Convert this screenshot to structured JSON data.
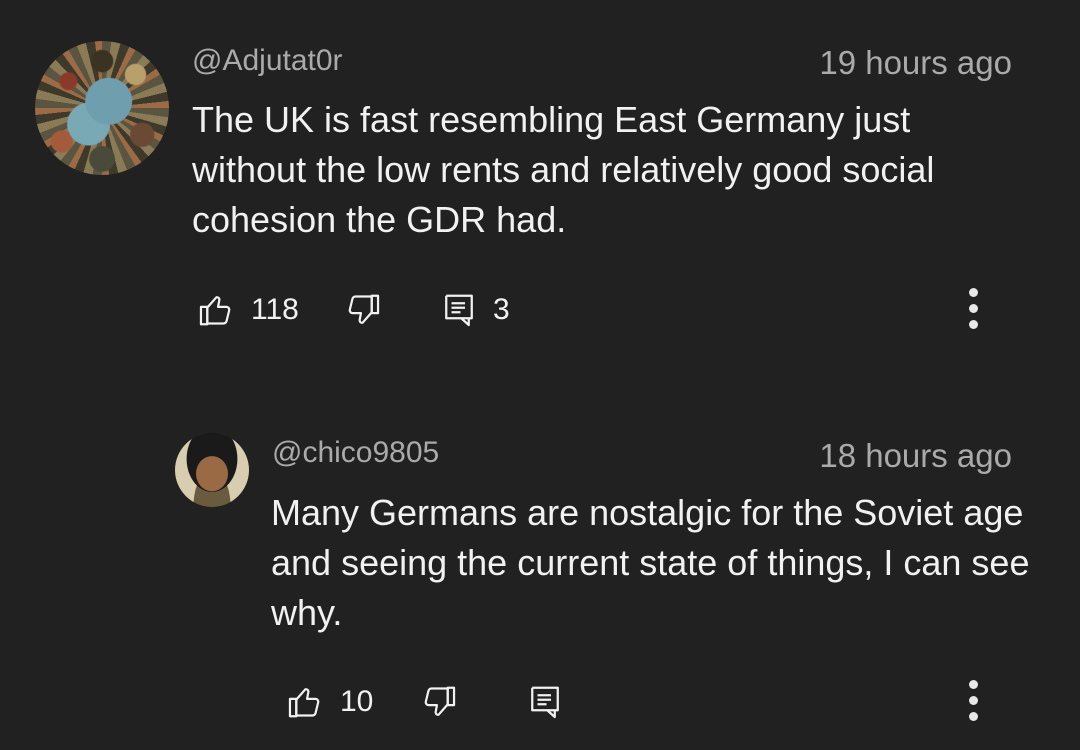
{
  "comments": [
    {
      "author": "@Adjutat0r",
      "time": "19 hours ago",
      "text": "The UK is fast resembling East Germany just without the low rents and relatively good social cohesion the GDR had.",
      "likes": "118",
      "replies": "3",
      "icons": {
        "like": "thumbs-up-icon",
        "dislike": "thumbs-down-icon",
        "reply": "reply-icon",
        "more": "more-vert-icon"
      }
    },
    {
      "author": "@chico9805",
      "time": "18 hours ago",
      "text": "Many Germans are nostalgic for the Soviet age and seeing the current state of things, I can see why.",
      "likes": "10",
      "replies": "",
      "icons": {
        "like": "thumbs-up-icon",
        "dislike": "thumbs-down-icon",
        "reply": "reply-icon",
        "more": "more-vert-icon"
      }
    }
  ],
  "colors": {
    "background": "#212121",
    "primary_text": "#f1f1f1",
    "secondary_text": "#aaaaaa"
  }
}
